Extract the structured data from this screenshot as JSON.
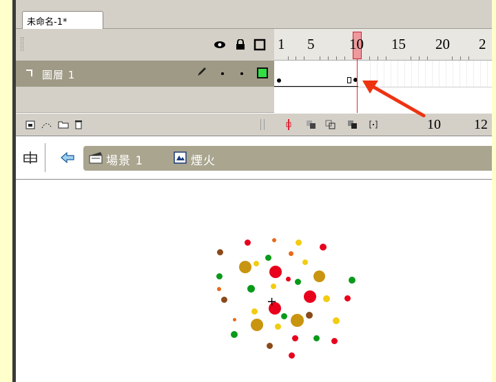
{
  "document": {
    "tab_title": "未命名-1*"
  },
  "timeline": {
    "ruler_numbers": [
      "1",
      "5",
      "10",
      "15",
      "20",
      "2"
    ],
    "current_frame": 10,
    "layer": {
      "name": "圖層 1"
    },
    "bottom_bar": {
      "current_frame": "10",
      "frame_rate": "12"
    }
  },
  "edit_bar": {
    "scene_label": "場景 1",
    "symbol_label": "煙火"
  },
  "icons": {
    "eye": "eye-icon",
    "lock": "lock-icon",
    "outline": "outline-icon",
    "pencil": "pencil-icon",
    "layer": "layer-icon",
    "back": "back-arrow-icon",
    "scene": "clapper-icon",
    "symbol": "movieclip-icon"
  },
  "colors": {
    "chrome": "#d4d0c8",
    "layer_row": "#9f9a86",
    "playhead": "#dd2233",
    "arrow": "#ee3311",
    "particle_red": "#e8001c",
    "particle_gold": "#c9940f",
    "particle_green": "#0a9a1a",
    "particle_brown": "#8a4a1a",
    "particle_yellow": "#f2cc10"
  }
}
